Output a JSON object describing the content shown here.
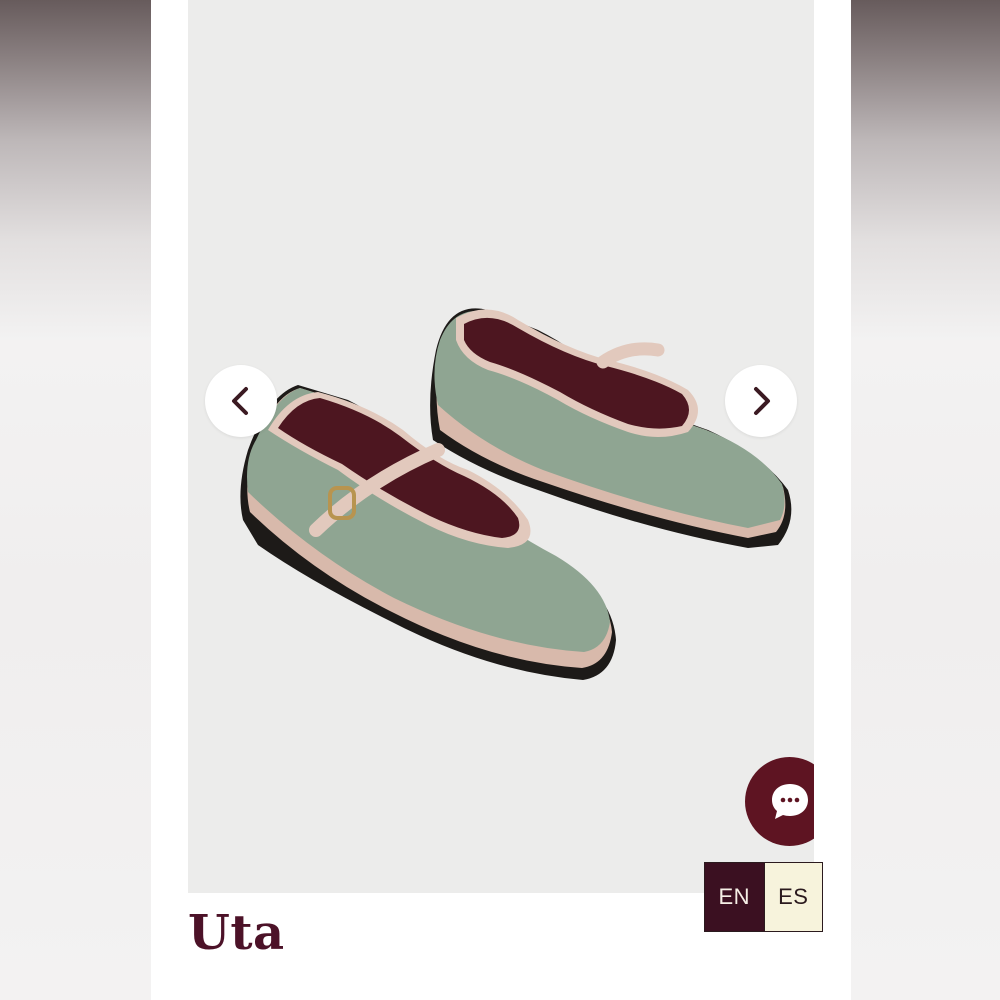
{
  "product": {
    "title": "Uta",
    "image_icon": "mary-jane-velvet-shoes-image"
  },
  "gallery": {
    "prev_icon": "chevron-left-icon",
    "next_icon": "chevron-right-icon"
  },
  "chat": {
    "icon": "chat-bubble-icon"
  },
  "language": {
    "options": [
      "EN",
      "ES"
    ],
    "selected": "EN"
  },
  "colors": {
    "brand": "#5e1422",
    "title": "#4c1228",
    "lang_selected_bg": "#3b1021",
    "lang_unselected_bg": "#f7f3dc",
    "shoe_velvet": "#8fa592",
    "shoe_trim": "#d9bcb0",
    "image_bg": "#ececeb"
  }
}
